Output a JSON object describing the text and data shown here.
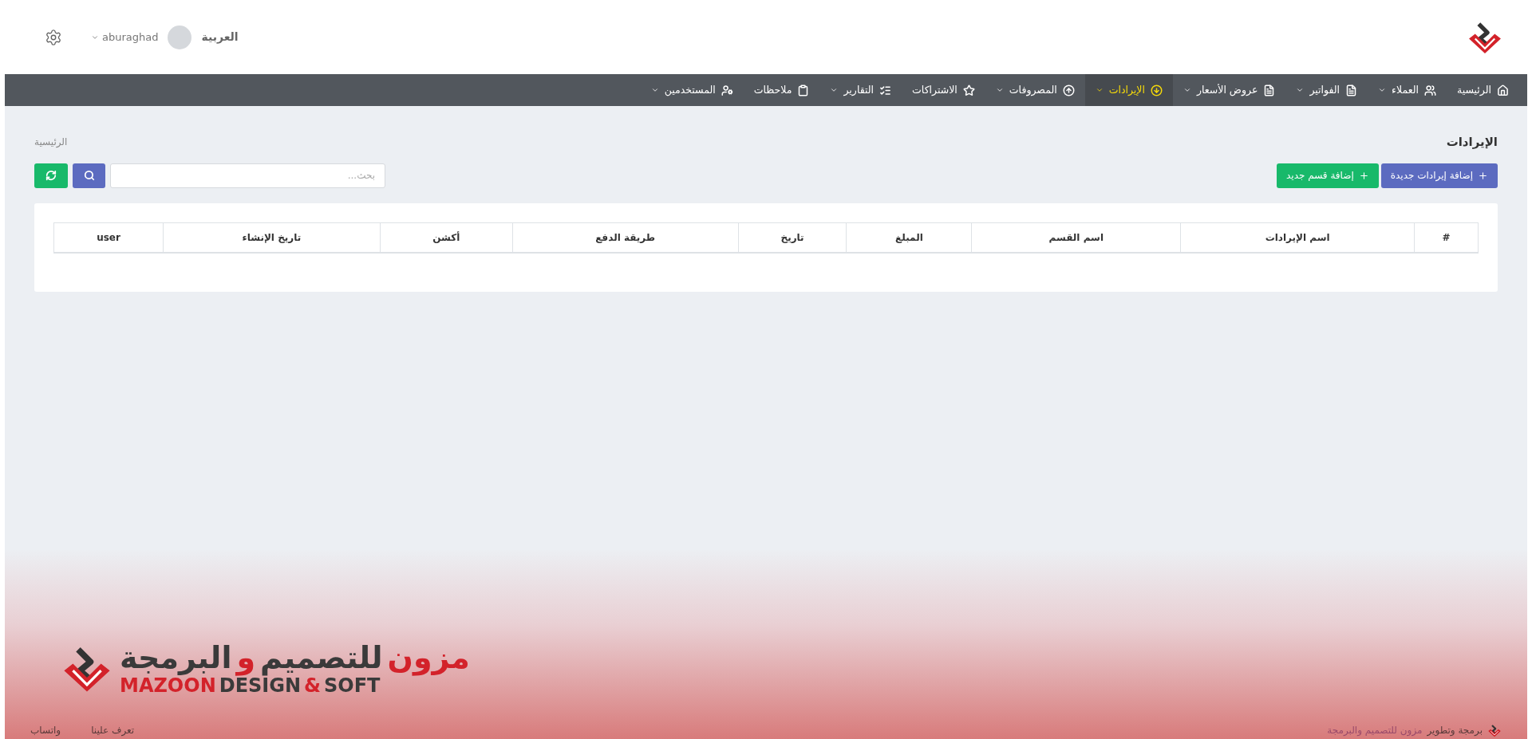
{
  "header": {
    "language": "العربية",
    "username": "aburaghad"
  },
  "nav": [
    {
      "label": "الرئيسية",
      "selected": false,
      "dropdown": false
    },
    {
      "label": "العملاء",
      "selected": false,
      "dropdown": true
    },
    {
      "label": "الفواتير",
      "selected": false,
      "dropdown": true
    },
    {
      "label": "عروض الأسعار",
      "selected": false,
      "dropdown": true
    },
    {
      "label": "الإيرادات",
      "selected": true,
      "dropdown": true
    },
    {
      "label": "المصروفات",
      "selected": false,
      "dropdown": true
    },
    {
      "label": "الاشتراكات",
      "selected": false,
      "dropdown": false
    },
    {
      "label": "التقارير",
      "selected": false,
      "dropdown": true
    },
    {
      "label": "ملاحظات",
      "selected": false,
      "dropdown": false
    },
    {
      "label": "المستخدمين",
      "selected": false,
      "dropdown": true
    }
  ],
  "page": {
    "title": "الإيرادات",
    "breadcrumb": "الرئيسية"
  },
  "actions": [
    "إضافة إيرادات جديدة",
    "إضافة قسم جديد"
  ],
  "search": {
    "placeholder": "بحث..."
  },
  "table": {
    "columns": [
      "#",
      "اسم الإيرادات",
      "اسم القسم",
      "المبلغ",
      "تاريخ",
      "طريقة الدفع",
      "أكشن",
      "تاريخ الإنشاء",
      "user"
    ]
  },
  "footer": {
    "logo_arabic": [
      {
        "text": "مزون",
        "accent": true
      },
      {
        "text": "للتصميم",
        "accent": false
      },
      {
        "text": "و",
        "accent": true
      },
      {
        "text": "البرمجة",
        "accent": false
      }
    ],
    "logo_latin": [
      {
        "text": "SOFT",
        "accent": false
      },
      {
        "text": "&",
        "accent": true
      },
      {
        "text": "DESIGN",
        "accent": false
      },
      {
        "text": "MAZOON",
        "accent": true
      }
    ],
    "credit": "برمجة وتطوير",
    "credit_link": "مزون للتصميم والبرمجة",
    "links": [
      "تعرف علينا",
      "واتساب"
    ]
  }
}
